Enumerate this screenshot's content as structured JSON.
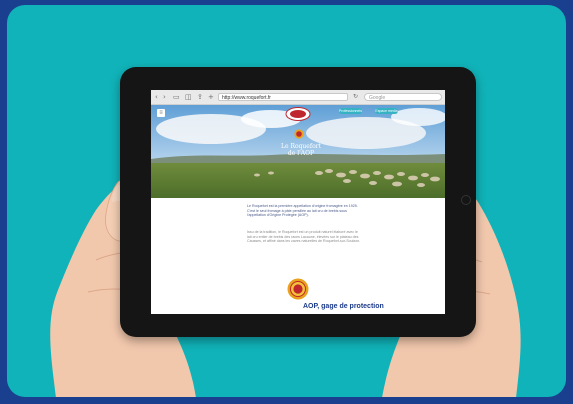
{
  "browser": {
    "url": "http://www.roquefort.fr",
    "search_placeholder": "Google"
  },
  "site": {
    "menu_label": "≡",
    "nav_buttons": [
      "Professionnels",
      "Espace media"
    ],
    "hero_title_line1": "Le Roquefort",
    "hero_title_line2": "de l'AOP",
    "intro_text": "Le Roquefort est la première appellation d'origine fromagère en 1925. C'est le seul fromage à pâte persillée au lait cru de brebis sous l'appellation d'Origine Protégée (AOP).",
    "body_text": "Issu de la tradition, le Roquefort est un produit naturel élaboré avec le lait cru entier de brebis des races Lacaune, élevées sur le plateau des Causses, et affiné dans les caves naturelles de Roquefort-sur-Soulzon.",
    "section_title": "AOP, gage de protection",
    "aop_badge": "AOP"
  },
  "colors": {
    "frame_blue": "#1b3f8f",
    "panel_teal": "#10b3b9",
    "tablet_bezel": "#151515",
    "title_navy": "#1d3b8a",
    "button_teal": "#35b3c4",
    "aop_orange": "#e8a21c",
    "aop_red": "#c0262d"
  }
}
